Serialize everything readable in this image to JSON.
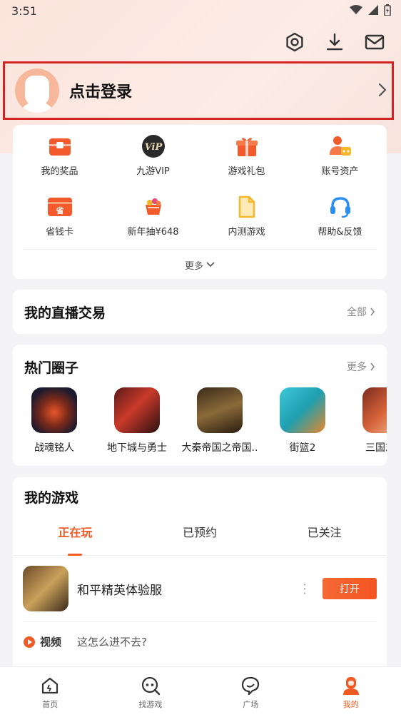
{
  "status_bar": {
    "time": "3:51"
  },
  "top_icons": [
    "settings-icon",
    "download-icon",
    "mail-icon"
  ],
  "login": {
    "label": "点击登录"
  },
  "quick_menu": {
    "items": [
      {
        "label": "我的奖品",
        "icon": "prize-icon",
        "color": "#f2592b"
      },
      {
        "label": "九游VIP",
        "icon": "vip-icon",
        "color": "#2a2a2a"
      },
      {
        "label": "游戏礼包",
        "icon": "gift-icon",
        "color": "#f2592b"
      },
      {
        "label": "账号资产",
        "icon": "account-assets-icon",
        "color": "#f2592b"
      },
      {
        "label": "省钱卡",
        "icon": "save-card-icon",
        "color": "#f2592b"
      },
      {
        "label": "新年抽¥648",
        "icon": "lottery-icon",
        "color": "#f2592b"
      },
      {
        "label": "内测游戏",
        "icon": "beta-test-icon",
        "color": "#f6b72a"
      },
      {
        "label": "帮助&反馈",
        "icon": "help-headset-icon",
        "color": "#2b8ef2"
      }
    ],
    "more_label": "更多"
  },
  "live_trade": {
    "title": "我的直播交易",
    "link": "全部"
  },
  "hot_circles": {
    "title": "热门圈子",
    "link": "更多",
    "items": [
      {
        "label": "战魂铭人",
        "color": "#2a1f3f"
      },
      {
        "label": "地下城与勇士",
        "color": "#3a1c1c"
      },
      {
        "label": "大秦帝国之帝国..",
        "color": "#4a3520"
      },
      {
        "label": "街篮2",
        "color": "#2fb3c7"
      },
      {
        "label": "三国志幻",
        "color": "#b24a3a"
      }
    ]
  },
  "my_games": {
    "title": "我的游戏",
    "tabs": [
      "正在玩",
      "已预约",
      "已关注"
    ],
    "active_tab": 0,
    "game": {
      "name": "和平精英体验服",
      "button": "打开"
    },
    "video": {
      "tag": "视频",
      "text": "这怎么进不去?"
    }
  },
  "bottom_nav": [
    {
      "label": "首页",
      "icon": "home-icon"
    },
    {
      "label": "找游戏",
      "icon": "find-game-icon"
    },
    {
      "label": "广场",
      "icon": "square-icon"
    },
    {
      "label": "我的",
      "icon": "profile-icon"
    }
  ],
  "colors": {
    "accent": "#f05a24",
    "highlight_border": "#d42424"
  }
}
